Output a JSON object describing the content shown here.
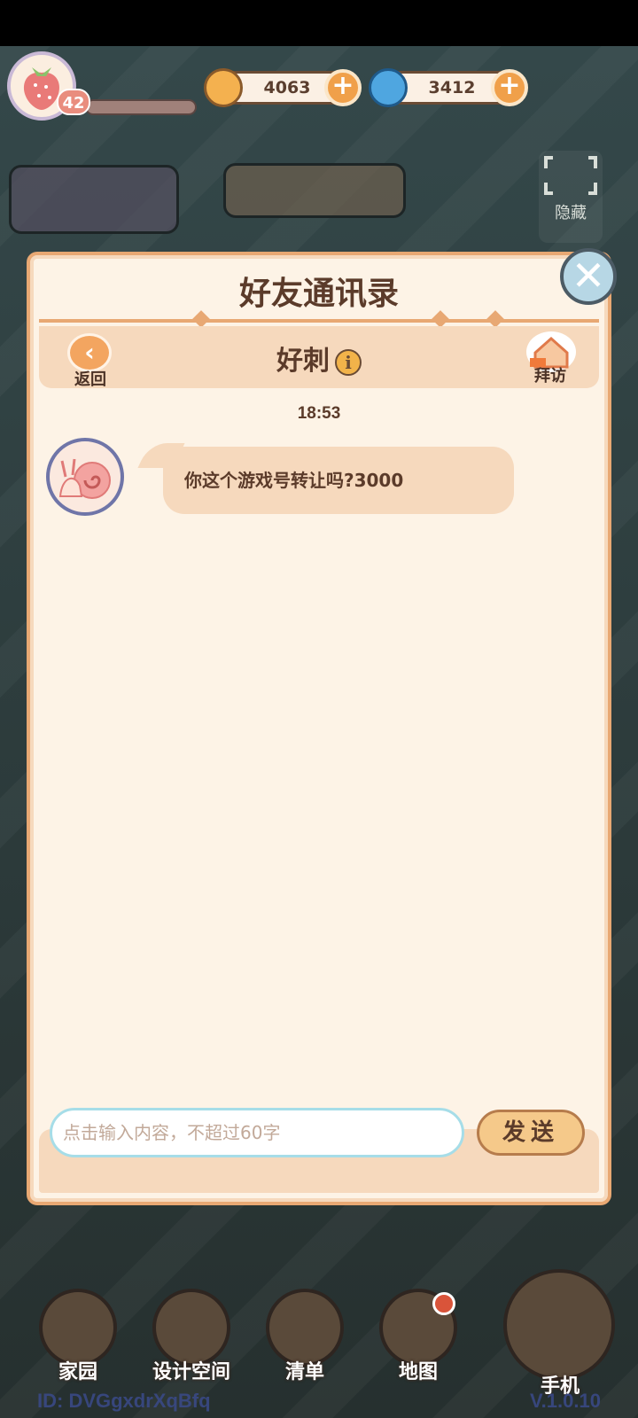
{
  "hud": {
    "level": "42",
    "coins": "4063",
    "gems": "3412",
    "plus": "+",
    "hide_label": "隐藏"
  },
  "dialog": {
    "title": "好友通讯录",
    "back_label": "返回",
    "visit_label": "拜访",
    "friend_name": "好刺",
    "info_glyph": "i",
    "close_glyph": "✕"
  },
  "chat": {
    "timestamp": "18:53",
    "messages": [
      {
        "sender": "friend",
        "text": "你这个游戏号转让吗?3000"
      }
    ],
    "input_placeholder": "点击输入内容，不超过60字",
    "send_label": "发送"
  },
  "bottom_nav": {
    "items": [
      {
        "label": "家园",
        "icon": "home-icon"
      },
      {
        "label": "设计空间",
        "icon": "design-icon"
      },
      {
        "label": "清单",
        "icon": "list-icon"
      },
      {
        "label": "地图",
        "icon": "map-pin-icon"
      }
    ],
    "phone_label": "手机"
  },
  "footer": {
    "user_id": "ID: DVGgxdrXqBfq",
    "version": "V.1.0.10"
  },
  "colors": {
    "panel_bg": "#fdf3e6",
    "panel_border": "#e8a873",
    "header_band": "#f6d9bd",
    "text_brown": "#5b3b2a",
    "accent_orange": "#f3a560"
  }
}
